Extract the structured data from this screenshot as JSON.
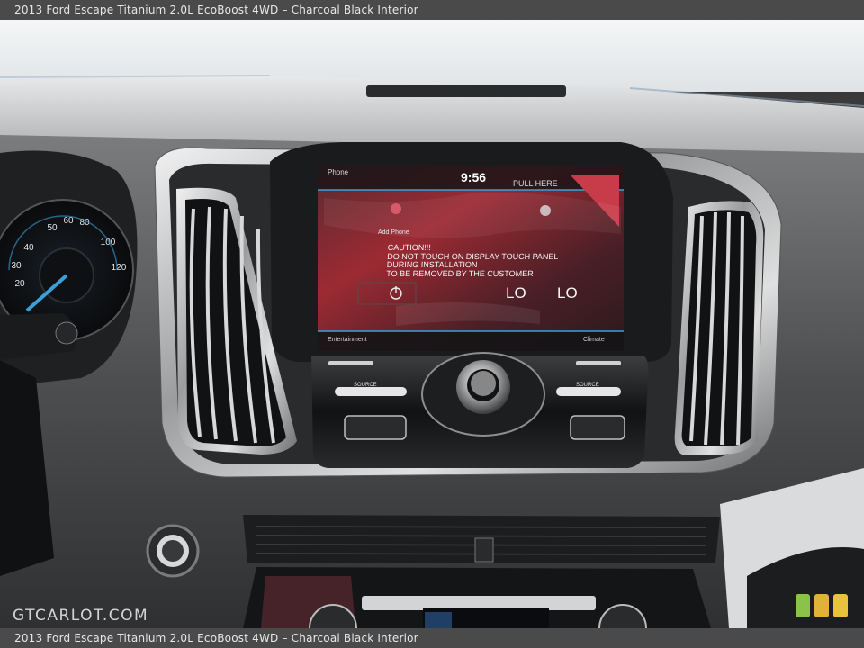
{
  "caption": {
    "top": "2013 Ford Escape Titanium 2.0L EcoBoost 4WD – Charcoal Black Interior",
    "bottom": "2013 Ford Escape Titanium 2.0L EcoBoost 4WD – Charcoal Black Interior"
  },
  "watermark": "GTCARLOT.COM",
  "screen": {
    "top_left": "Phone",
    "time": "9:56",
    "pull_here": "PULL HERE",
    "add_phone": "Add Phone",
    "caution": [
      "CAUTION!!!",
      "DO NOT TOUCH ON DISPLAY TOUCH PANEL",
      "DURING INSTALLATION",
      "TO BE REMOVED BY THE CUSTOMER"
    ],
    "temp_left": "LO",
    "temp_right": "LO",
    "bottom_left": "Entertainment",
    "bottom_right": "Climate"
  },
  "buttons": {
    "source_left": "SOURCE",
    "source_right": "SOURCE"
  },
  "colors": {
    "dash": "#2e2e2f",
    "screen_red": "#8e2a30",
    "accent_blue": "#3aa0d8",
    "badge": [
      "#8bc34a",
      "#e0b23a",
      "#e8c23f"
    ]
  }
}
